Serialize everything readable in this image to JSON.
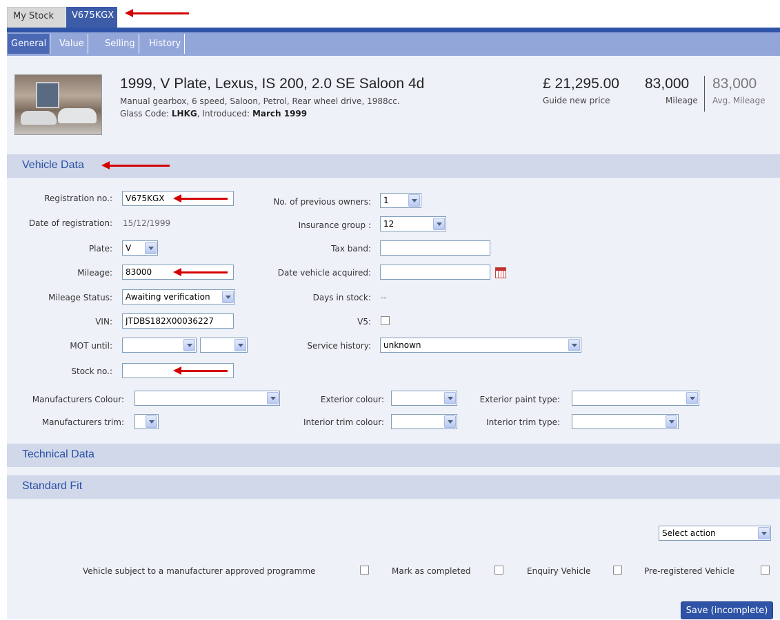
{
  "tabs": {
    "my_stock": "My Stock",
    "vehicle": "V675KGX"
  },
  "subtabs": [
    "General",
    "Value",
    "Selling",
    "History"
  ],
  "header": {
    "title": "1999, V Plate, Lexus, IS 200, 2.0 SE Saloon 4d",
    "description": "Manual gearbox, 6 speed, Saloon, Petrol, Rear wheel drive, 1988cc.",
    "glass_code_label": "Glass Code:",
    "glass_code": "LHKG",
    "introduced_label": ", Introduced:",
    "introduced": "March 1999",
    "guide_price": "£ 21,295.00",
    "guide_price_label": "Guide new price",
    "mileage": "83,000",
    "mileage_label": "Mileage",
    "avg_mileage": "83,000",
    "avg_mileage_label": "Avg. Mileage"
  },
  "sections": {
    "vehicle_data": "Vehicle Data",
    "technical_data": "Technical Data",
    "standard_fit": "Standard Fit"
  },
  "fields": {
    "registration_label": "Registration no.:",
    "registration": "V675KGX",
    "date_reg_label": "Date of registration:",
    "date_reg": "15/12/1999",
    "plate_label": "Plate:",
    "plate": "V",
    "mileage_label": "Mileage:",
    "mileage": "83000",
    "mileage_status_label": "Mileage Status:",
    "mileage_status": "Awaiting verification",
    "vin_label": "VIN:",
    "vin": "JTDBS182X00036227",
    "mot_label": "MOT until:",
    "stock_label": "Stock no.:",
    "prev_owners_label": "No. of previous owners:",
    "prev_owners": "1",
    "insurance_label": "Insurance group :",
    "insurance": "12",
    "tax_band_label": "Tax band:",
    "date_acquired_label": "Date vehicle acquired:",
    "days_stock_label": "Days in stock:",
    "days_stock": "--",
    "v5_label": "V5:",
    "service_label": "Service history:",
    "service": "unknown",
    "mfr_colour_label": "Manufacturers Colour:",
    "ext_colour_label": "Exterior colour:",
    "ext_paint_label": "Exterior paint type:",
    "mfr_trim_label": "Manufacturers trim:",
    "int_trim_colour_label": "Interior trim colour:",
    "int_trim_type_label": "Interior trim type:"
  },
  "actions": {
    "select_action": "Select action",
    "approved_programme": "Vehicle subject to a manufacturer approved programme",
    "mark_completed": "Mark as completed",
    "enquiry": "Enquiry Vehicle",
    "pre_registered": "Pre-registered Vehicle",
    "save": "Save (incomplete)"
  },
  "colors": {
    "accent": "#2f54a7",
    "subbar": "#93a6d9",
    "section": "#d0d8ea",
    "panel": "#eef1f8",
    "annotation_arrow": "#d40000"
  }
}
